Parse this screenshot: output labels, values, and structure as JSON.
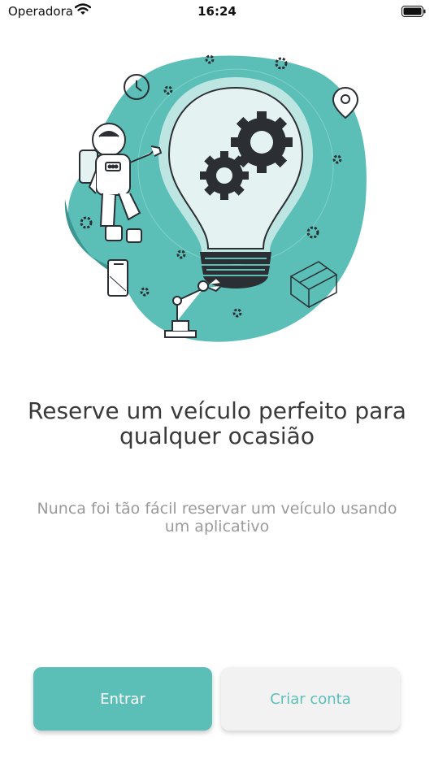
{
  "status_bar": {
    "carrier": "Operadora",
    "time": "16:24"
  },
  "hero": {
    "illustration_icons": [
      "lightbulb-icon",
      "gear-icon",
      "astronaut-icon",
      "map-pin-icon",
      "clock-icon",
      "phone-icon",
      "robot-arm-icon",
      "box-icon"
    ],
    "colors": {
      "blob": "#5bbfb8",
      "blob_dark": "#3d9690",
      "bulb": "#e4f3f2",
      "stroke": "#2b2f33"
    }
  },
  "content": {
    "title": "Reserve um veículo perfeito para qualquer ocasião",
    "subtitle": "Nunca foi tão fácil reservar um veículo usando um aplicativo"
  },
  "actions": {
    "login_label": "Entrar",
    "signup_label": "Criar conta"
  },
  "colors": {
    "accent": "#5bbfb8",
    "title_text": "#3a3a3a",
    "subtitle_text": "#9a9a9a",
    "secondary_button_bg": "#f2f2f2"
  }
}
